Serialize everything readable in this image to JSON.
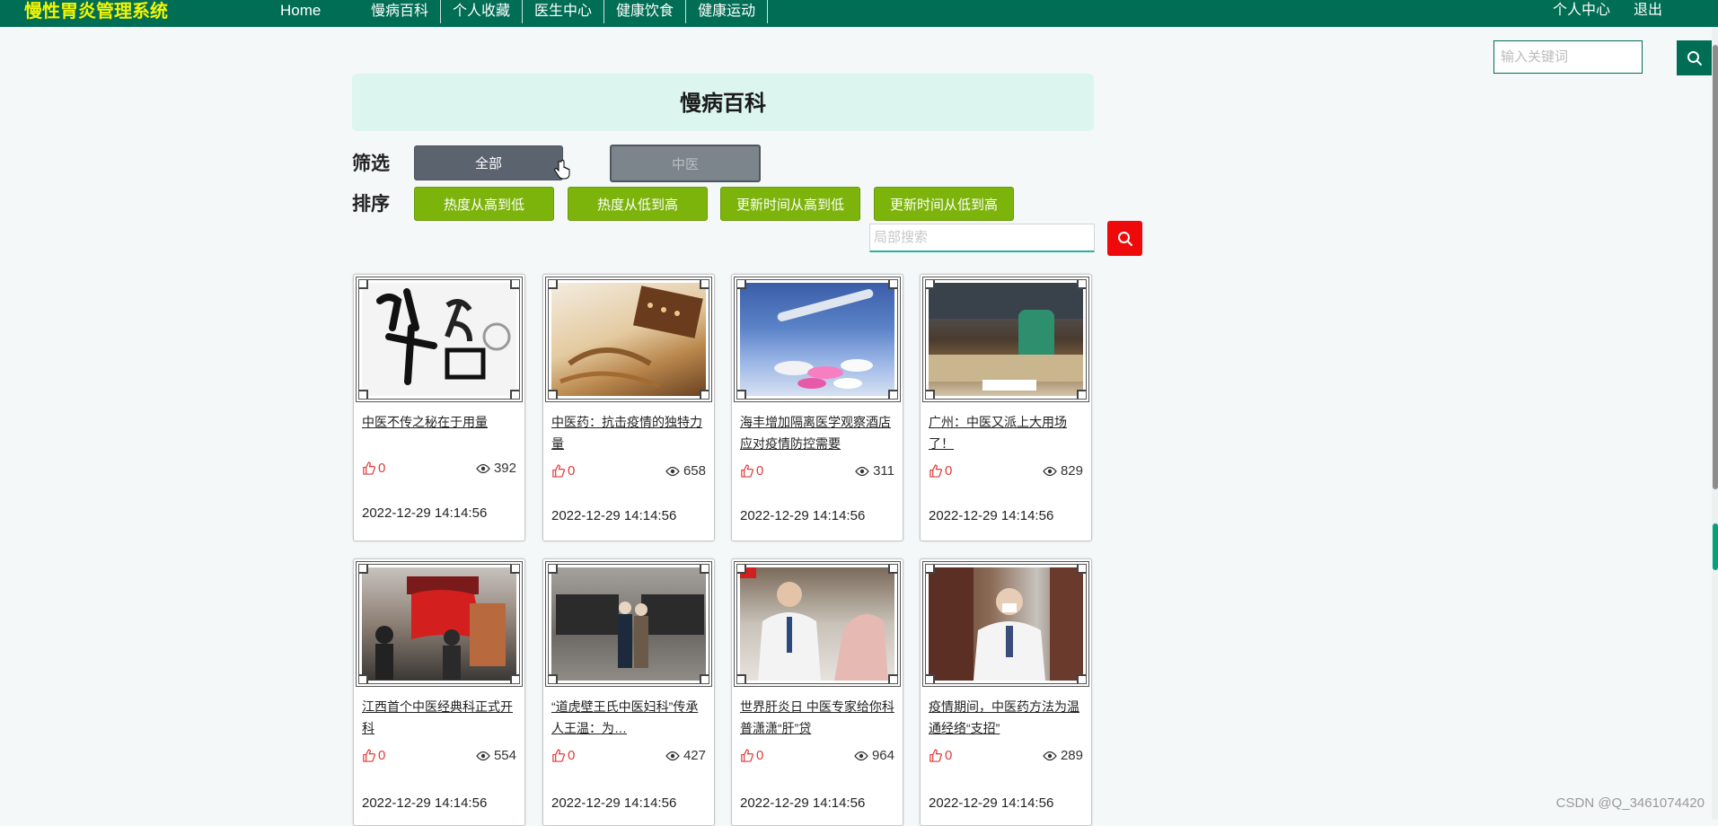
{
  "nav": {
    "brand": "慢性胃炎管理系统",
    "home": "Home",
    "items": [
      "慢病百科",
      "个人收藏",
      "医生中心",
      "健康饮食",
      "健康运动"
    ],
    "right": [
      "个人中心",
      "退出"
    ]
  },
  "global_search": {
    "placeholder": "输入关键词"
  },
  "page": {
    "title": "慢病百科"
  },
  "filter": {
    "label": "筛选",
    "options": [
      "全部",
      "中医"
    ]
  },
  "sort": {
    "label": "排序",
    "options": [
      "热度从高到低",
      "热度从低到高",
      "更新时间从高到低",
      "更新时间从低到高"
    ]
  },
  "local_search": {
    "placeholder": "局部搜索"
  },
  "colors": {
    "nav": "#006d55",
    "brand": "#f2f500",
    "sort_button": "#7cb40b",
    "search_button": "#ee0a0a"
  },
  "articles": [
    {
      "title": "中医不传之秘在于用量",
      "likes": "0",
      "views": "392",
      "date": "2022-12-29 14:14:56"
    },
    {
      "title": "中医药：抗击疫情的独特力量",
      "likes": "0",
      "views": "658",
      "date": "2022-12-29 14:14:56"
    },
    {
      "title": "海丰增加隔离医学观察酒店 应对疫情防控需要",
      "likes": "0",
      "views": "311",
      "date": "2022-12-29 14:14:56"
    },
    {
      "title": "广州：中医又派上大用场了！",
      "likes": "0",
      "views": "829",
      "date": "2022-12-29 14:14:56"
    },
    {
      "title": "江西首个中医经典科正式开科",
      "likes": "0",
      "views": "554",
      "date": "2022-12-29 14:14:56"
    },
    {
      "title": "“道虎壁王氏中医妇科”传承人王温：为…",
      "likes": "0",
      "views": "427",
      "date": "2022-12-29 14:14:56"
    },
    {
      "title": "世界肝炎日 中医专家给你科普潇潇“肝”贷",
      "likes": "0",
      "views": "964",
      "date": "2022-12-29 14:14:56"
    },
    {
      "title": "疫情期间，中医药方法为温通经络“支招”",
      "likes": "0",
      "views": "289",
      "date": "2022-12-29 14:14:56"
    }
  ],
  "watermark": "CSDN @Q_3461074420"
}
